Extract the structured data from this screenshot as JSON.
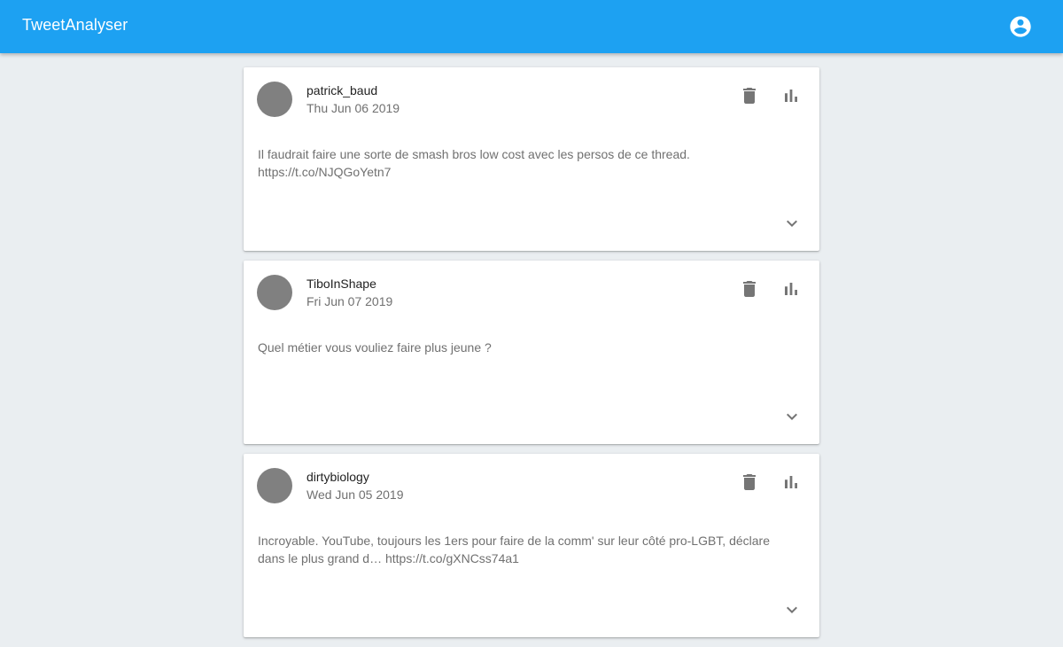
{
  "app": {
    "title": "TweetAnalyser",
    "accent_color": "#1da1f2",
    "account_icon": "account-circle-icon"
  },
  "tweets": [
    {
      "username": "patrick_baud",
      "date": "Thu Jun 06 2019",
      "text_lines": [
        "Il faudrait faire une sorte de smash bros low cost avec les persos de ce thread.",
        "https://t.co/NJQGoYetn7"
      ]
    },
    {
      "username": "TiboInShape",
      "date": "Fri Jun 07 2019",
      "text_lines": [
        "Quel métier vous vouliez faire plus jeune ?"
      ]
    },
    {
      "username": "dirtybiology",
      "date": "Wed Jun 05 2019",
      "text_lines": [
        "Incroyable. YouTube, toujours les 1ers pour faire de la comm' sur leur côté pro-LGBT, déclare",
        "dans le plus grand d… https://t.co/gXNCss74a1"
      ]
    }
  ],
  "icons": {
    "delete": "delete-icon",
    "stats": "bar-chart-icon",
    "expand": "chevron-down-icon"
  }
}
